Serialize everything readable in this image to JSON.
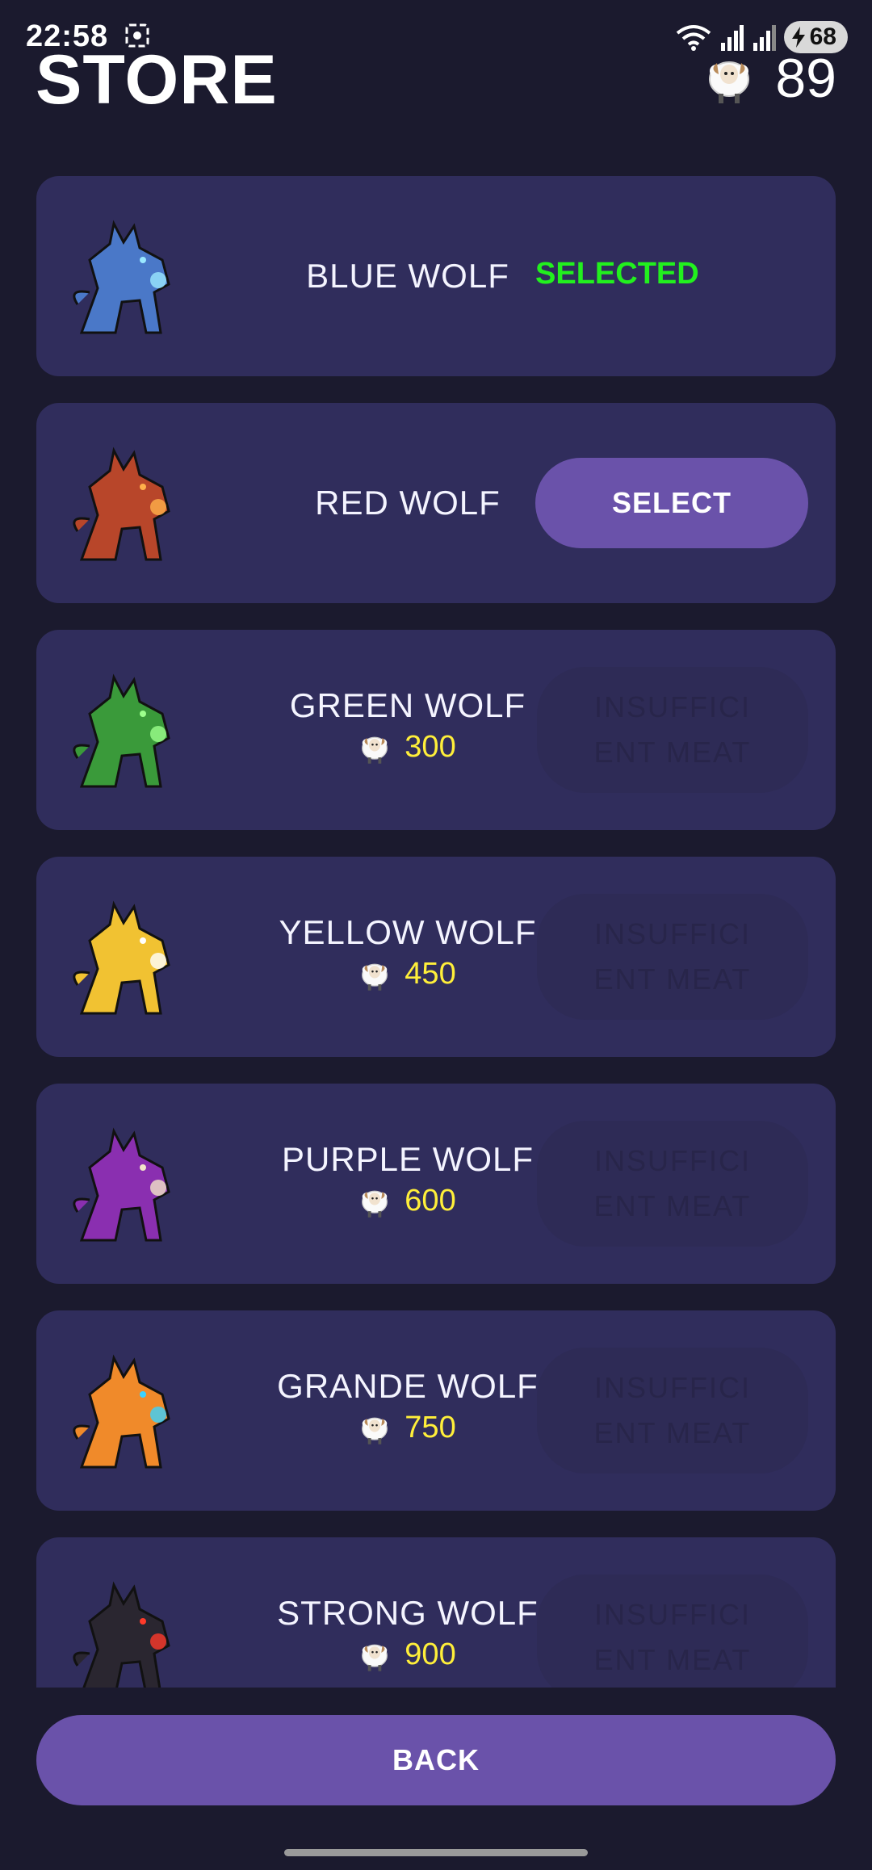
{
  "status_bar": {
    "time": "22:58",
    "battery": "68"
  },
  "header": {
    "title": "STORE",
    "meat_count": "89",
    "meat_icon": "sheep-icon"
  },
  "wolves": [
    {
      "name": "BLUE WOLF",
      "state": "selected",
      "status_label": "SELECTED",
      "color": "#4a78c8",
      "accent": "#9ae8ff"
    },
    {
      "name": "RED WOLF",
      "state": "owned",
      "button_label": "SELECT",
      "color": "#b8462a",
      "accent": "#ffb04a"
    },
    {
      "name": "GREEN WOLF",
      "state": "locked",
      "price": "300",
      "button_label": "INSUFFICI\nENT MEAT",
      "color": "#3a9a3a",
      "accent": "#9cff8c"
    },
    {
      "name": "YELLOW WOLF",
      "state": "locked",
      "price": "450",
      "button_label": "INSUFFICI\nENT MEAT",
      "color": "#f1c232",
      "accent": "#ffffff"
    },
    {
      "name": "PURPLE WOLF",
      "state": "locked",
      "price": "600",
      "button_label": "INSUFFICI\nENT MEAT",
      "color": "#8a2fb0",
      "accent": "#f2e6c8"
    },
    {
      "name": "GRANDE WOLF",
      "state": "locked",
      "price": "750",
      "button_label": "INSUFFICI\nENT MEAT",
      "color": "#f08a2a",
      "accent": "#3ad2ff"
    },
    {
      "name": "STRONG WOLF",
      "state": "locked",
      "price": "900",
      "button_label": "INSUFFICI\nENT MEAT",
      "color": "#2a2630",
      "accent": "#ff3a2a"
    }
  ],
  "footer": {
    "back_label": "BACK"
  }
}
